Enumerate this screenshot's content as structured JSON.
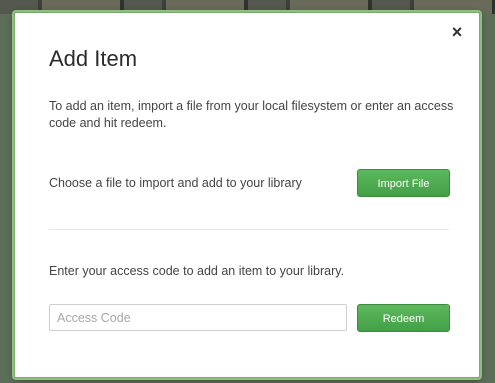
{
  "modal": {
    "title": "Add Item",
    "close_label": "×",
    "intro": "To add an item, import a file from your local filesystem or enter an access code and hit redeem.",
    "import": {
      "label": "Choose a file to import and add to your library",
      "button_label": "Import File"
    },
    "access_code": {
      "label": "Enter your access code to add an item to your library.",
      "input_placeholder": "Access Code",
      "input_value": "",
      "button_label": "Redeem"
    }
  },
  "colors": {
    "accent_green": "#4cae4c",
    "modal_border": "#8fbf80"
  },
  "icons": {
    "close": "close-icon"
  }
}
